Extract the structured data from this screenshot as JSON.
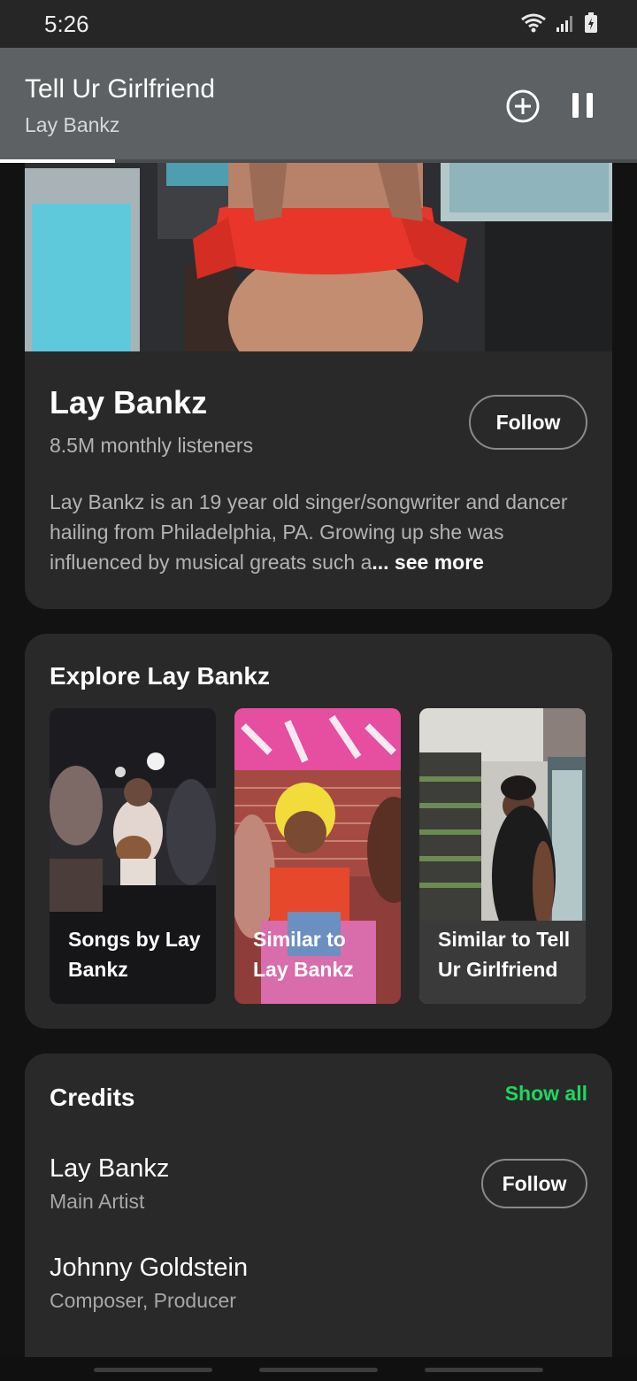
{
  "status_bar": {
    "time": "5:26",
    "icons": [
      "wifi-icon",
      "signal-icon",
      "battery-icon"
    ]
  },
  "mini_player": {
    "track_title": "Tell Ur Girlfriend",
    "artist": "Lay Bankz",
    "progress": 0.18,
    "icons": [
      "add-circle-icon",
      "pause-icon"
    ]
  },
  "artist": {
    "name": "Lay Bankz",
    "monthly_listeners": "8.5M monthly listeners",
    "follow_label": "Follow",
    "bio_text": "Lay Bankz is an 19 year old singer/songwriter and dancer hailing from Philadelphia, PA. Growing up she was influenced by musical greats such a",
    "see_more_label": "... see more"
  },
  "explore": {
    "title": "Explore Lay Bankz",
    "tiles": [
      {
        "label": "Songs by Lay Bankz"
      },
      {
        "label": "Similar to Lay Bankz"
      },
      {
        "label": "Similar to Tell Ur Girlfriend"
      }
    ]
  },
  "credits": {
    "title": "Credits",
    "show_all_label": "Show all",
    "items": [
      {
        "name": "Lay Bankz",
        "role": "Main Artist",
        "follow_label": "Follow"
      },
      {
        "name": "Johnny Goldstein",
        "role": "Composer, Producer"
      }
    ]
  },
  "colors": {
    "background": "#121212",
    "card": "#292929",
    "mini_player": "#5d6163",
    "accent_green": "#1ed760",
    "secondary_text": "#b3b3b3"
  }
}
